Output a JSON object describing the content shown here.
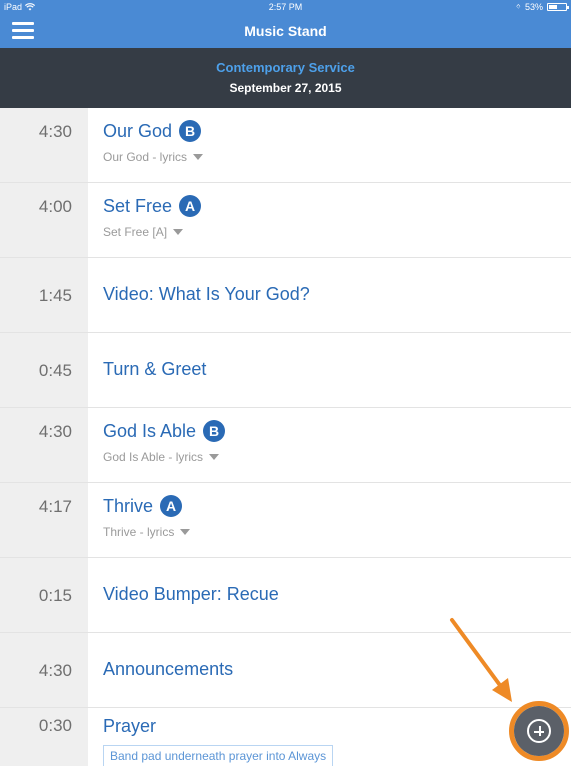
{
  "status_bar": {
    "device": "iPad",
    "time": "2:57 PM",
    "battery": "53%",
    "battery_level": 0.53
  },
  "nav": {
    "title": "Music Stand"
  },
  "service": {
    "name": "Contemporary Service",
    "date": "September 27, 2015"
  },
  "items": [
    {
      "time": "4:30",
      "title": "Our God",
      "key": "B",
      "arrangement": "Our God - lyrics"
    },
    {
      "time": "4:00",
      "title": "Set Free",
      "key": "A",
      "arrangement": "Set Free [A]"
    },
    {
      "time": "1:45",
      "title": "Video: What Is Your God?"
    },
    {
      "time": "0:45",
      "title": "Turn & Greet"
    },
    {
      "time": "4:30",
      "title": "God Is Able",
      "key": "B",
      "arrangement": "God Is Able - lyrics"
    },
    {
      "time": "4:17",
      "title": "Thrive",
      "key": "A",
      "arrangement": "Thrive - lyrics"
    },
    {
      "time": "0:15",
      "title": "Video Bumper: Recue"
    },
    {
      "time": "4:30",
      "title": "Announcements"
    },
    {
      "time": "0:30",
      "title": "Prayer",
      "note": "Band pad underneath prayer into Always"
    }
  ],
  "colors": {
    "accent": "#4a8ad4",
    "header_dark": "#353c45",
    "title_blue": "#2a6ab5",
    "highlight_orange": "#ee8a26"
  },
  "icons": {
    "menu": "hamburger-menu-icon",
    "add": "plus-circle-icon"
  }
}
